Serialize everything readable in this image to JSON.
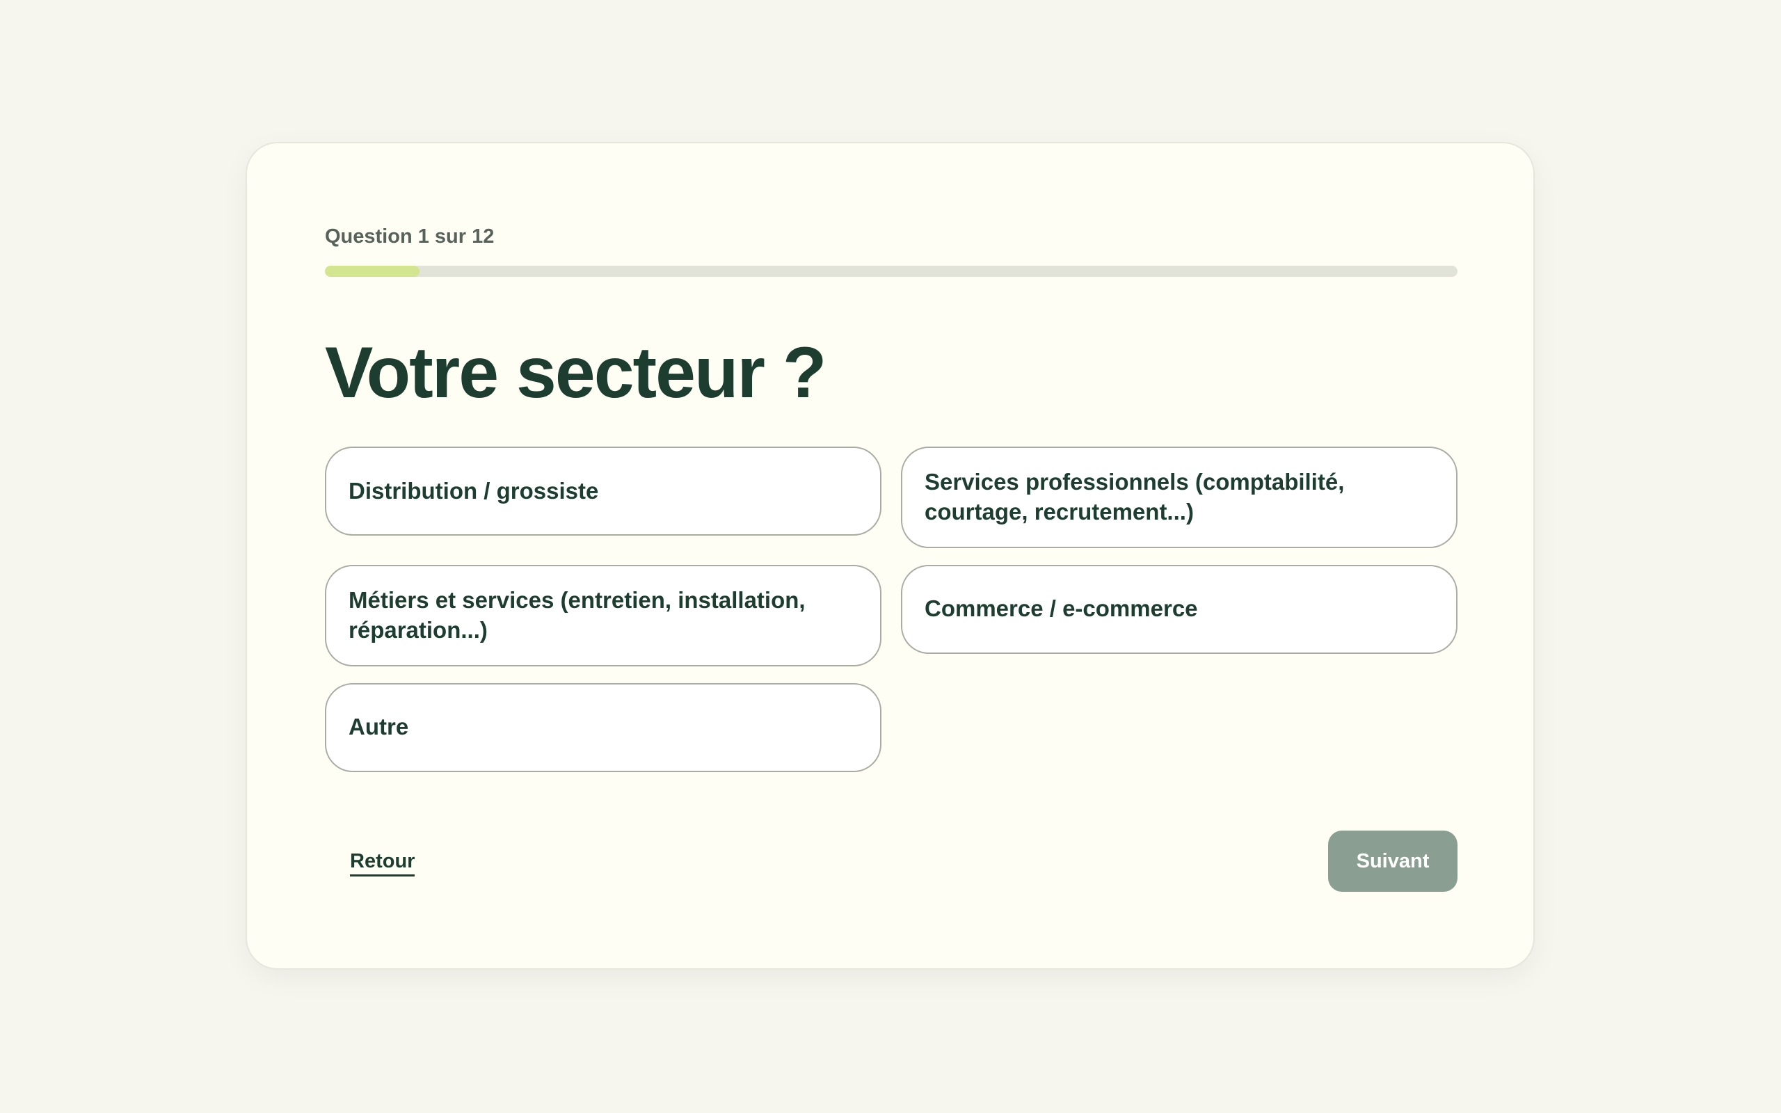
{
  "quiz": {
    "step_label": "Question 1 sur 12",
    "progress": {
      "current": 1,
      "total": 12,
      "fill_color": "#d3e68f"
    },
    "title": "Votre secteur ?",
    "options": [
      {
        "label": "Distribution / grossiste"
      },
      {
        "label": "Services professionnels (comptabilité, courtage, recrutement...)"
      },
      {
        "label": "Métiers et services (entretien, installation, réparation...)"
      },
      {
        "label": "Commerce / e-commerce"
      },
      {
        "label": "Autre"
      }
    ]
  },
  "footer": {
    "back_label": "Retour",
    "next_label": "Suivant",
    "next_state": "disabled"
  },
  "colors": {
    "background": "#f6f6ef",
    "card": "#fefef5",
    "primary_text": "#1c3d30",
    "muted_text": "#56625a",
    "next_button": "#8a9e91"
  }
}
